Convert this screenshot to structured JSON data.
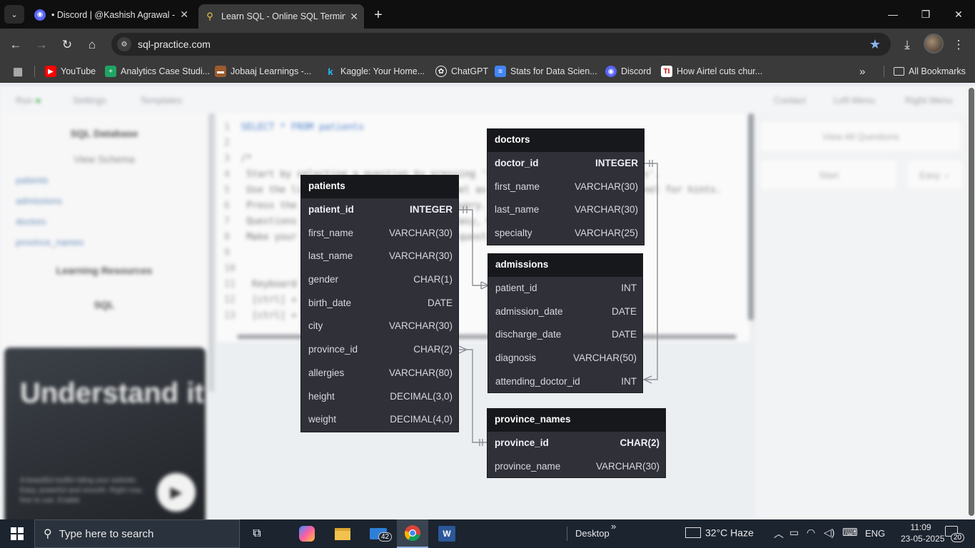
{
  "browser": {
    "tabs": [
      {
        "title": "• Discord | @Kashish Agrawal -",
        "icon": "discord-icon",
        "active": false
      },
      {
        "title": "Learn SQL - Online SQL Terminal",
        "icon": "sql-practice-key-icon",
        "active": true
      }
    ],
    "url": "sql-practice.com",
    "bookmarks": [
      {
        "label": "YouTube",
        "icon": "youtube-icon",
        "color": "#ff0000"
      },
      {
        "label": "Analytics Case Studi...",
        "icon": "sheets-icon",
        "color": "#1fa463"
      },
      {
        "label": "Jobaaj Learnings -...",
        "icon": "briefcase-icon",
        "color": "#9c5b2e"
      },
      {
        "label": "Kaggle: Your Home...",
        "icon": "kaggle-icon",
        "color": "#20beff"
      },
      {
        "label": "ChatGPT",
        "icon": "chatgpt-icon",
        "color": "#ffffff"
      },
      {
        "label": "Stats for Data Scien...",
        "icon": "docs-icon",
        "color": "#4285f4"
      },
      {
        "label": "Discord",
        "icon": "discord-icon",
        "color": "#5865f2"
      },
      {
        "label": "How Airtel cuts chur...",
        "icon": "ti-icon",
        "color": "#c00000"
      }
    ],
    "all_bookmarks": "All Bookmarks"
  },
  "page": {
    "topbar": [
      "Run",
      "Settings",
      "Templates",
      "Contact",
      "Left Menu",
      "Right Menu"
    ],
    "left": {
      "heading": "SQL Database",
      "view_schema": "View Schema",
      "tables": [
        "patients",
        "admissions",
        "doctors",
        "province_names"
      ],
      "learning": "Learning Resources",
      "sql": "SQL",
      "promo_title": "Understand it",
      "promo_text": "A beautiful toolkit riding your website. Easy, powerful and smooth. Right now, free to use. Enable"
    },
    "editor_lines": [
      "SELECT * FROM patients",
      "",
      "/*",
      "  Start by selecting a question by pressing 'Start' or 'View All Questions'.",
      "  Use the list of tables in the left panel as reference. Use the right panel for hints.",
      "  Press the keyboard shortcut to run a query.",
      "  Questions are grouped by difficulty: Easy, Medium, Hard.",
      "  Make your query correct to finish the question.",
      "",
      "",
      "  Keyboard shortcuts",
      "    [ctrl] + [enter]",
      "    [ctrl] + [space]"
    ],
    "right": {
      "view_all": "View All Questions",
      "start": "Start",
      "difficulty": "Easy"
    }
  },
  "schema": {
    "patients": {
      "title": "patients",
      "rows": [
        {
          "col": "patient_id",
          "type": "INTEGER",
          "pk": true
        },
        {
          "col": "first_name",
          "type": "VARCHAR(30)"
        },
        {
          "col": "last_name",
          "type": "VARCHAR(30)"
        },
        {
          "col": "gender",
          "type": "CHAR(1)"
        },
        {
          "col": "birth_date",
          "type": "DATE"
        },
        {
          "col": "city",
          "type": "VARCHAR(30)"
        },
        {
          "col": "province_id",
          "type": "CHAR(2)"
        },
        {
          "col": "allergies",
          "type": "VARCHAR(80)"
        },
        {
          "col": "height",
          "type": "DECIMAL(3,0)"
        },
        {
          "col": "weight",
          "type": "DECIMAL(4,0)"
        }
      ]
    },
    "doctors": {
      "title": "doctors",
      "rows": [
        {
          "col": "doctor_id",
          "type": "INTEGER",
          "pk": true
        },
        {
          "col": "first_name",
          "type": "VARCHAR(30)"
        },
        {
          "col": "last_name",
          "type": "VARCHAR(30)"
        },
        {
          "col": "specialty",
          "type": "VARCHAR(25)"
        }
      ]
    },
    "admissions": {
      "title": "admissions",
      "rows": [
        {
          "col": "patient_id",
          "type": "INT"
        },
        {
          "col": "admission_date",
          "type": "DATE"
        },
        {
          "col": "discharge_date",
          "type": "DATE"
        },
        {
          "col": "diagnosis",
          "type": "VARCHAR(50)"
        },
        {
          "col": "attending_doctor_id",
          "type": "INT"
        }
      ]
    },
    "province_names": {
      "title": "province_names",
      "rows": [
        {
          "col": "province_id",
          "type": "CHAR(2)",
          "pk": true
        },
        {
          "col": "province_name",
          "type": "VARCHAR(30)"
        }
      ]
    }
  },
  "taskbar": {
    "search_placeholder": "Type here to search",
    "mail_badge": "42",
    "desktop": "Desktop",
    "weather": "32°C  Haze",
    "lang": "ENG",
    "time": "11:09",
    "date": "23-05-2025",
    "notifications": "20"
  }
}
